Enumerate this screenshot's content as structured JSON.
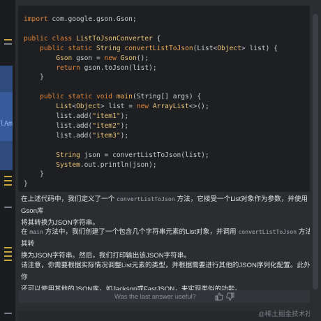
{
  "code": {
    "lines": [
      [
        {
          "c": "kw",
          "t": "import"
        },
        {
          "c": "tx",
          "t": " com.google.gson.Gson;"
        }
      ],
      [],
      [
        {
          "c": "kw",
          "t": "public class"
        },
        {
          "c": "ty",
          "t": " ListToJsonConverter"
        },
        {
          "c": "tx",
          "t": " {"
        }
      ],
      [
        {
          "c": "tx",
          "t": "    "
        },
        {
          "c": "kw",
          "t": "public static"
        },
        {
          "c": "ty",
          "t": " String"
        },
        {
          "c": "fn",
          "t": " convertListToJson"
        },
        {
          "c": "tx",
          "t": "(List<"
        },
        {
          "c": "ty",
          "t": "Object"
        },
        {
          "c": "tx",
          "t": "> list) {"
        }
      ],
      [
        {
          "c": "tx",
          "t": "        "
        },
        {
          "c": "ty",
          "t": "Gson"
        },
        {
          "c": "tx",
          "t": " gson = "
        },
        {
          "c": "kw",
          "t": "new"
        },
        {
          "c": "ty",
          "t": " Gson"
        },
        {
          "c": "tx",
          "t": "();"
        }
      ],
      [
        {
          "c": "tx",
          "t": "        "
        },
        {
          "c": "kw",
          "t": "return"
        },
        {
          "c": "tx",
          "t": " gson.toJson(list);"
        }
      ],
      [
        {
          "c": "tx",
          "t": "    }"
        }
      ],
      [],
      [
        {
          "c": "tx",
          "t": "    "
        },
        {
          "c": "kw",
          "t": "public static void"
        },
        {
          "c": "fn",
          "t": " main"
        },
        {
          "c": "tx",
          "t": "(String[] args) {"
        }
      ],
      [
        {
          "c": "tx",
          "t": "        "
        },
        {
          "c": "ty",
          "t": "List"
        },
        {
          "c": "tx",
          "t": "<"
        },
        {
          "c": "ty",
          "t": "Object"
        },
        {
          "c": "tx",
          "t": "> list = "
        },
        {
          "c": "kw",
          "t": "new"
        },
        {
          "c": "ty",
          "t": " ArrayList"
        },
        {
          "c": "tx",
          "t": "<>();"
        }
      ],
      [
        {
          "c": "tx",
          "t": "        list.add("
        },
        {
          "c": "st",
          "t": "\"item1\""
        },
        {
          "c": "tx",
          "t": ");"
        }
      ],
      [
        {
          "c": "tx",
          "t": "        list.add("
        },
        {
          "c": "st",
          "t": "\"item2\""
        },
        {
          "c": "tx",
          "t": ");"
        }
      ],
      [
        {
          "c": "tx",
          "t": "        list.add("
        },
        {
          "c": "st",
          "t": "\"item3\""
        },
        {
          "c": "tx",
          "t": ");"
        }
      ],
      [],
      [
        {
          "c": "tx",
          "t": "        "
        },
        {
          "c": "ty",
          "t": "String"
        },
        {
          "c": "tx",
          "t": " json = convertListToJson(list);"
        }
      ],
      [
        {
          "c": "tx",
          "t": "        "
        },
        {
          "c": "ty",
          "t": "System"
        },
        {
          "c": "tx",
          "t": ".out.println(json);"
        }
      ],
      [
        {
          "c": "tx",
          "t": "    }"
        }
      ],
      [
        {
          "c": "tx",
          "t": "}"
        }
      ]
    ]
  },
  "answer": {
    "p1": {
      "a": "在上述代码中，我们定义了一个 ",
      "code": "convertListToJson",
      "b": " 方法，它接受一个List对象作为参数，并使用Gson库",
      "c": "将其转换为JSON字符串。"
    },
    "p2": {
      "a": "在 ",
      "code1": "main",
      "b": " 方法中，我们创建了一个包含几个字符串元素的List对象，并调用 ",
      "code2": "convertListToJson",
      "c": " 方法将其转",
      "d": "换为JSON字符串。然后，我们打印输出该JSON字符串。"
    },
    "p3": {
      "a": "请注意，你需要根据实际情况调整List元素的类型，并根据需要进行其他的JSON序列化配置。此外，你",
      "b": "还可以使用其他的JSON库，如Jackson或FastJSON，来实现类似的功能。"
    }
  },
  "feedback": {
    "question": "Was the last answer useful?"
  },
  "gutter": {
    "fold_label": "lAm"
  },
  "watermark": "@稀土掘金技术社区",
  "colors": {
    "keyword": "#e0863b",
    "type": "#e8c476",
    "background": "#1e1f22"
  }
}
